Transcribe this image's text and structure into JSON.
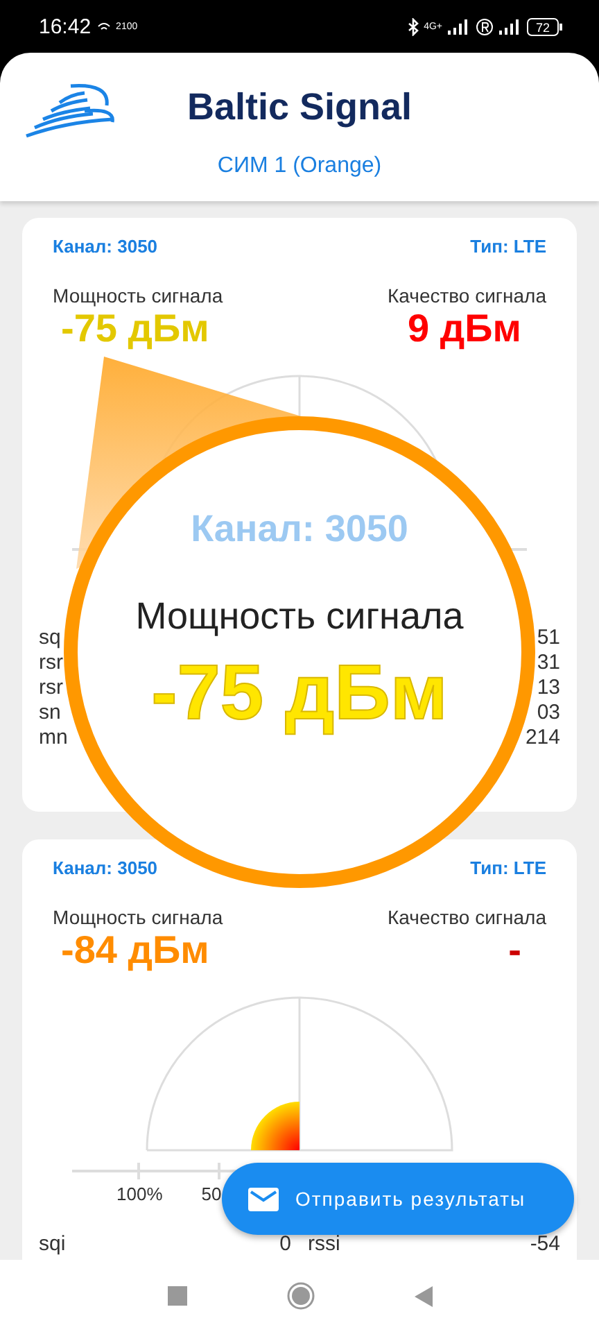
{
  "status_bar": {
    "time": "16:42",
    "wifi_band": "2100",
    "network": "4G+",
    "battery": "72"
  },
  "header": {
    "title": "Baltic Signal",
    "subtitle": "СИМ 1 (Orange)"
  },
  "cards": [
    {
      "channel": "Канал: 3050",
      "type": "Тип: LTE",
      "readings": [
        {
          "label": "Мощность сигнала",
          "value": "-75 дБм",
          "color": "#e3c800"
        },
        {
          "label": "Качество сигнала",
          "value": "9 дБм",
          "color": "#ff0000"
        }
      ],
      "stats": [
        {
          "left_label": "sq",
          "right_value": "51"
        },
        {
          "left_label": "rsr",
          "right_value": "31"
        },
        {
          "left_label": "rsr",
          "right_value": "13"
        },
        {
          "left_label": "sn",
          "right_value": "03"
        },
        {
          "left_label": "mn",
          "right_value": "214"
        }
      ]
    },
    {
      "channel": "Канал: 3050",
      "type": "Тип: LTE",
      "gauge_fill": true,
      "readings": [
        {
          "label": "Мощность сигнала",
          "value": "-84 дБм",
          "color": "#ff8c00"
        },
        {
          "label": "Качество сигнала",
          "value": "-",
          "color": "#cc0000"
        }
      ],
      "axis_labels": [
        "100%",
        "50"
      ],
      "stats": [
        {
          "left_label": "sqi",
          "left_value": "0",
          "right_label": "rssi",
          "right_value": "-54"
        }
      ]
    }
  ],
  "magnifier": {
    "channel": "Канал: 3050",
    "label": "Мощность сигнала",
    "value": "-75 дБм"
  },
  "fab": {
    "label": "Отправить результаты"
  }
}
